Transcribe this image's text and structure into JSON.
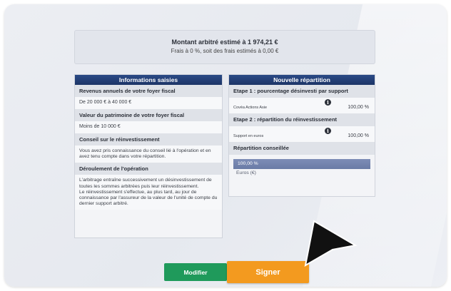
{
  "summary": {
    "line1": "Montant arbitré estimé à 1 974,21 €",
    "line2": "Frais à 0 %, soit des frais estimés à 0,00 €"
  },
  "left_panel": {
    "title": "Informations saisies",
    "revenus_label": "Revenus annuels de votre foyer fiscal",
    "revenus_value": "De 20 000 € à 40 000 €",
    "patrimoine_label": "Valeur du patrimoine de votre foyer fiscal",
    "patrimoine_value": "Moins de 10 000 €",
    "conseil_label": "Conseil sur le réinvestissement",
    "conseil_text": "Vous avez pris connaissance du conseil lié à l'opération et en avez tenu compte dans votre répartition.",
    "deroulement_label": "Déroulement de l'opération",
    "deroulement_text_1": "L'arbitrage entraîne successivement un désinvestissement de toutes les sommes arbitrées puis leur réinvestissement.",
    "deroulement_text_2": "Le réinvestissement s'effectue, au plus tard, au jour de connaissance par l'assureur de la valeur de l'unité de compte du dernier support arbitré."
  },
  "right_panel": {
    "title": "Nouvelle répartition",
    "step1_label": "Etape 1 : pourcentage désinvesti par support",
    "step1_fund": "Covéa Actions Asie",
    "step1_pct": "100,00 %",
    "step2_label": "Etape 2 : répartition du réinvestissement",
    "step2_fund": "Support en euros",
    "step2_pct": "100,00 %",
    "repartition_label": "Répartition conseillée",
    "bar_value": "100,00 %",
    "bar_caption": "Euros (€)",
    "bar_fill": 1.0
  },
  "buttons": {
    "modifier": "Modifier",
    "signer": "Signer"
  },
  "icons": {
    "info": "info-icon",
    "cursor": "mouse-pointer-icon"
  },
  "colors": {
    "header_blue": "#1d3567",
    "modifier_green": "#1f9a5b",
    "signer_orange": "#f39a1f",
    "bar_blue": "#6a7ba6"
  }
}
